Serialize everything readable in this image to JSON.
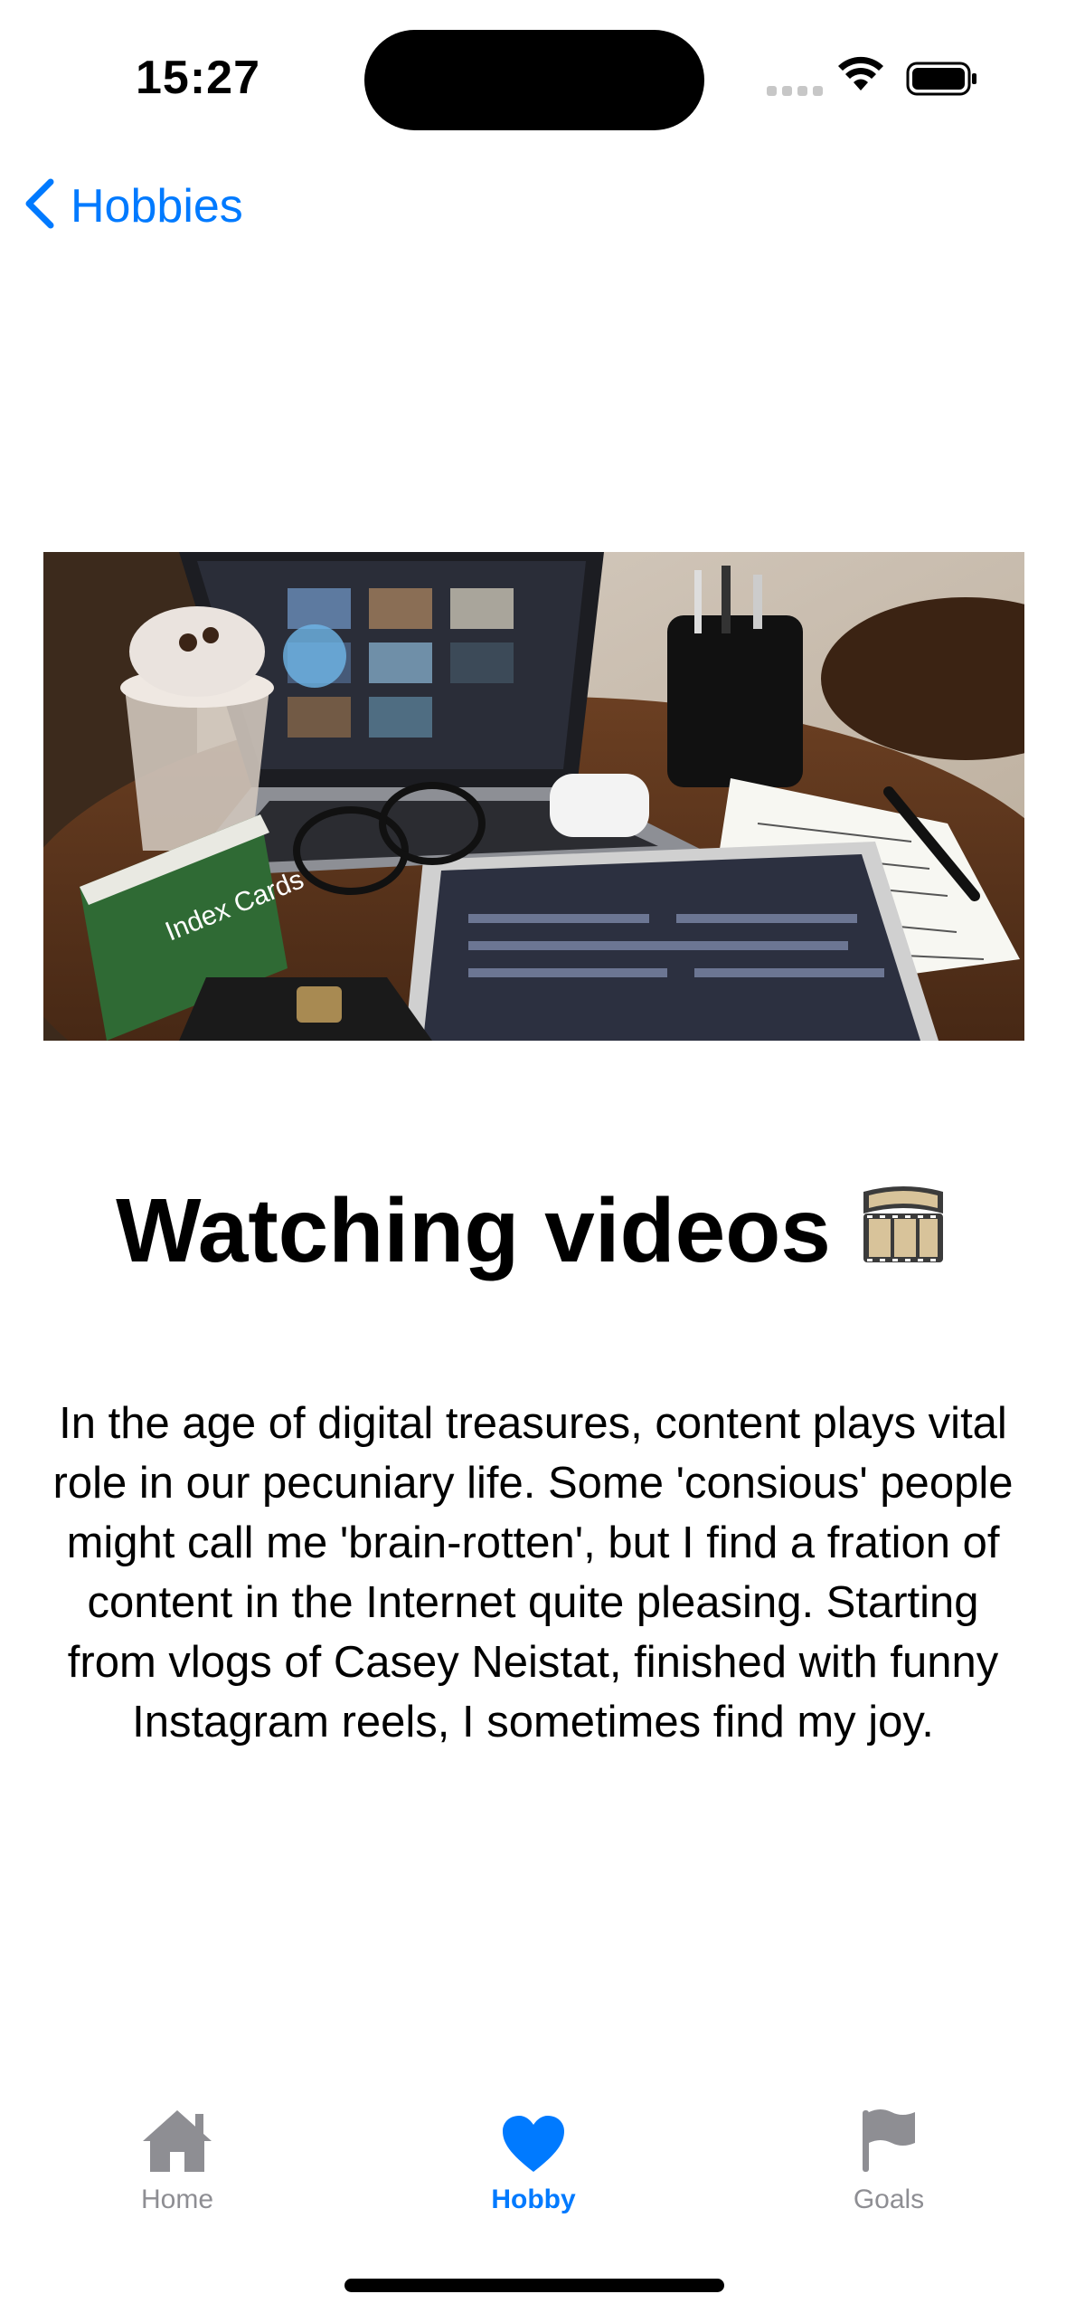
{
  "status_bar": {
    "time": "15:27"
  },
  "nav": {
    "back_label": "Hobbies"
  },
  "hero_image": {
    "description_icon": "photo"
  },
  "content": {
    "title": "Watching videos",
    "title_emoji_icon": "film-reel-icon",
    "body": "In the age of digital treasures, content plays vital role in our pecuniary life. Some 'consious' people might call me 'brain-rotten', but I find a fration of content in the Internet quite pleasing. Starting from vlogs of Casey Neistat, finished with funny Instagram reels, I sometimes find my joy."
  },
  "tab_bar": {
    "tabs": [
      {
        "label": "Home",
        "icon": "house-icon",
        "selected": false
      },
      {
        "label": "Hobby",
        "icon": "heart-icon",
        "selected": true
      },
      {
        "label": "Goals",
        "icon": "flag-icon",
        "selected": false
      }
    ]
  },
  "colors": {
    "accent": "#007aff",
    "inactive": "#8e8e93"
  }
}
